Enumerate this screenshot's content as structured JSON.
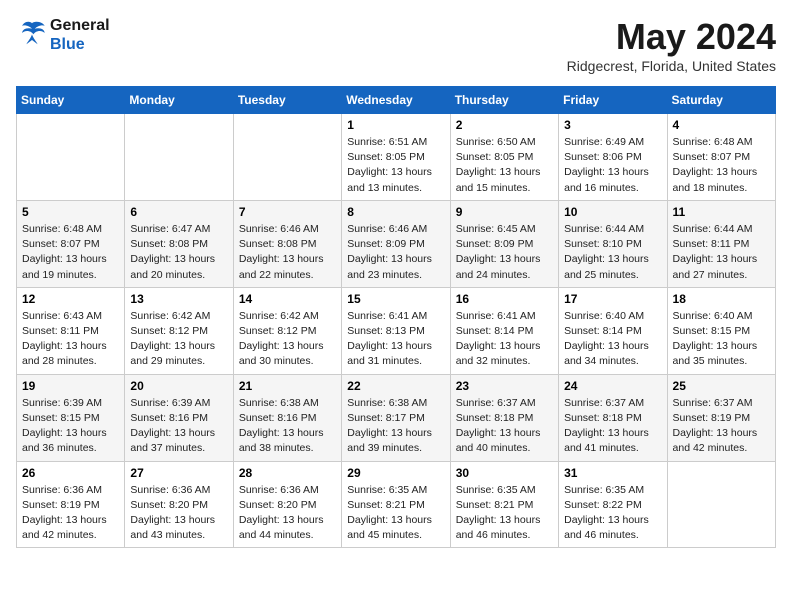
{
  "logo": {
    "text_general": "General",
    "text_blue": "Blue"
  },
  "title": "May 2024",
  "location": "Ridgecrest, Florida, United States",
  "days_of_week": [
    "Sunday",
    "Monday",
    "Tuesday",
    "Wednesday",
    "Thursday",
    "Friday",
    "Saturday"
  ],
  "weeks": [
    [
      {
        "day": "",
        "info": ""
      },
      {
        "day": "",
        "info": ""
      },
      {
        "day": "",
        "info": ""
      },
      {
        "day": "1",
        "info": "Sunrise: 6:51 AM\nSunset: 8:05 PM\nDaylight: 13 hours and 13 minutes."
      },
      {
        "day": "2",
        "info": "Sunrise: 6:50 AM\nSunset: 8:05 PM\nDaylight: 13 hours and 15 minutes."
      },
      {
        "day": "3",
        "info": "Sunrise: 6:49 AM\nSunset: 8:06 PM\nDaylight: 13 hours and 16 minutes."
      },
      {
        "day": "4",
        "info": "Sunrise: 6:48 AM\nSunset: 8:07 PM\nDaylight: 13 hours and 18 minutes."
      }
    ],
    [
      {
        "day": "5",
        "info": "Sunrise: 6:48 AM\nSunset: 8:07 PM\nDaylight: 13 hours and 19 minutes."
      },
      {
        "day": "6",
        "info": "Sunrise: 6:47 AM\nSunset: 8:08 PM\nDaylight: 13 hours and 20 minutes."
      },
      {
        "day": "7",
        "info": "Sunrise: 6:46 AM\nSunset: 8:08 PM\nDaylight: 13 hours and 22 minutes."
      },
      {
        "day": "8",
        "info": "Sunrise: 6:46 AM\nSunset: 8:09 PM\nDaylight: 13 hours and 23 minutes."
      },
      {
        "day": "9",
        "info": "Sunrise: 6:45 AM\nSunset: 8:09 PM\nDaylight: 13 hours and 24 minutes."
      },
      {
        "day": "10",
        "info": "Sunrise: 6:44 AM\nSunset: 8:10 PM\nDaylight: 13 hours and 25 minutes."
      },
      {
        "day": "11",
        "info": "Sunrise: 6:44 AM\nSunset: 8:11 PM\nDaylight: 13 hours and 27 minutes."
      }
    ],
    [
      {
        "day": "12",
        "info": "Sunrise: 6:43 AM\nSunset: 8:11 PM\nDaylight: 13 hours and 28 minutes."
      },
      {
        "day": "13",
        "info": "Sunrise: 6:42 AM\nSunset: 8:12 PM\nDaylight: 13 hours and 29 minutes."
      },
      {
        "day": "14",
        "info": "Sunrise: 6:42 AM\nSunset: 8:12 PM\nDaylight: 13 hours and 30 minutes."
      },
      {
        "day": "15",
        "info": "Sunrise: 6:41 AM\nSunset: 8:13 PM\nDaylight: 13 hours and 31 minutes."
      },
      {
        "day": "16",
        "info": "Sunrise: 6:41 AM\nSunset: 8:14 PM\nDaylight: 13 hours and 32 minutes."
      },
      {
        "day": "17",
        "info": "Sunrise: 6:40 AM\nSunset: 8:14 PM\nDaylight: 13 hours and 34 minutes."
      },
      {
        "day": "18",
        "info": "Sunrise: 6:40 AM\nSunset: 8:15 PM\nDaylight: 13 hours and 35 minutes."
      }
    ],
    [
      {
        "day": "19",
        "info": "Sunrise: 6:39 AM\nSunset: 8:15 PM\nDaylight: 13 hours and 36 minutes."
      },
      {
        "day": "20",
        "info": "Sunrise: 6:39 AM\nSunset: 8:16 PM\nDaylight: 13 hours and 37 minutes."
      },
      {
        "day": "21",
        "info": "Sunrise: 6:38 AM\nSunset: 8:16 PM\nDaylight: 13 hours and 38 minutes."
      },
      {
        "day": "22",
        "info": "Sunrise: 6:38 AM\nSunset: 8:17 PM\nDaylight: 13 hours and 39 minutes."
      },
      {
        "day": "23",
        "info": "Sunrise: 6:37 AM\nSunset: 8:18 PM\nDaylight: 13 hours and 40 minutes."
      },
      {
        "day": "24",
        "info": "Sunrise: 6:37 AM\nSunset: 8:18 PM\nDaylight: 13 hours and 41 minutes."
      },
      {
        "day": "25",
        "info": "Sunrise: 6:37 AM\nSunset: 8:19 PM\nDaylight: 13 hours and 42 minutes."
      }
    ],
    [
      {
        "day": "26",
        "info": "Sunrise: 6:36 AM\nSunset: 8:19 PM\nDaylight: 13 hours and 42 minutes."
      },
      {
        "day": "27",
        "info": "Sunrise: 6:36 AM\nSunset: 8:20 PM\nDaylight: 13 hours and 43 minutes."
      },
      {
        "day": "28",
        "info": "Sunrise: 6:36 AM\nSunset: 8:20 PM\nDaylight: 13 hours and 44 minutes."
      },
      {
        "day": "29",
        "info": "Sunrise: 6:35 AM\nSunset: 8:21 PM\nDaylight: 13 hours and 45 minutes."
      },
      {
        "day": "30",
        "info": "Sunrise: 6:35 AM\nSunset: 8:21 PM\nDaylight: 13 hours and 46 minutes."
      },
      {
        "day": "31",
        "info": "Sunrise: 6:35 AM\nSunset: 8:22 PM\nDaylight: 13 hours and 46 minutes."
      },
      {
        "day": "",
        "info": ""
      }
    ]
  ]
}
